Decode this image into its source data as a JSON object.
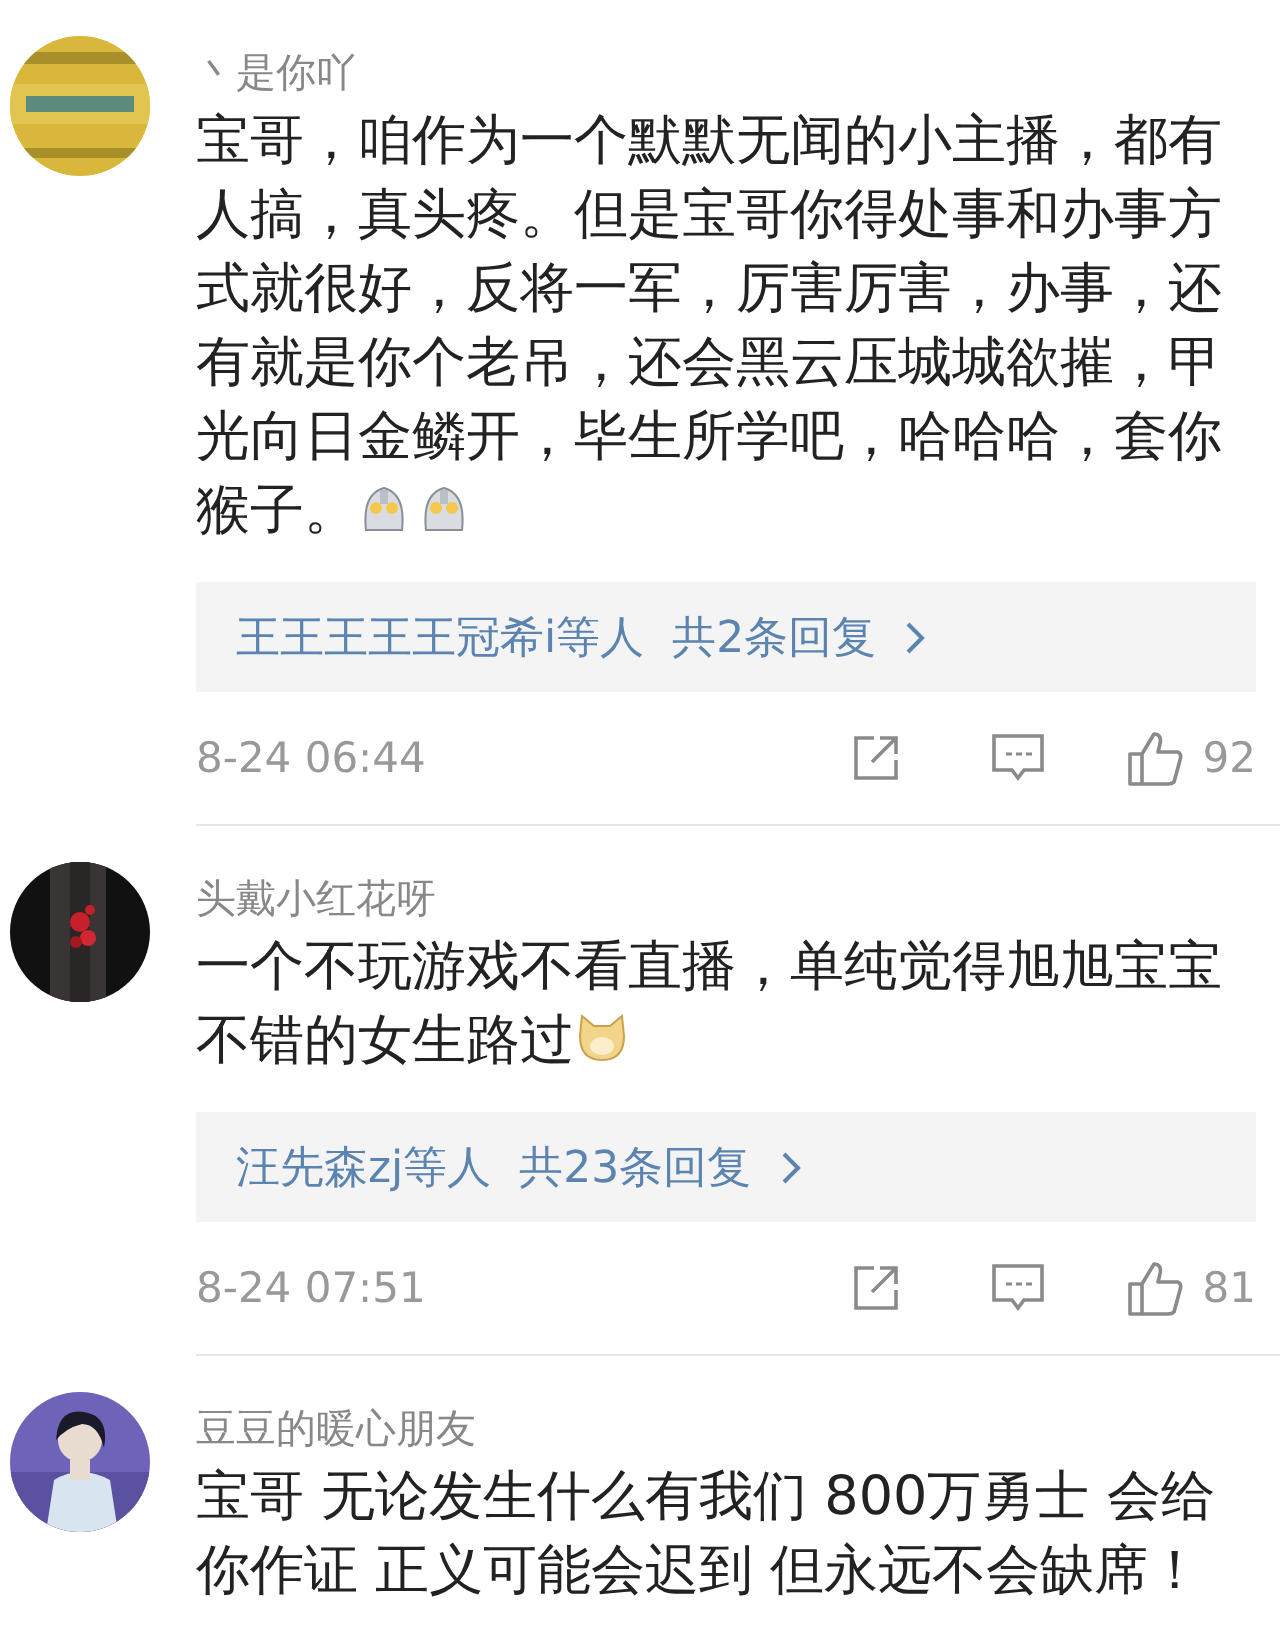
{
  "comments": [
    {
      "name": "丶是你吖",
      "text": "宝哥，咱作为一个默默无闻的小主播，都有人搞，真头疼。但是宝哥你得处事和办事方式就很好，反将一军，厉害厉害，办事，还有就是你个老吊，还会黑云压城城欲摧，甲光向日金鳞开，毕生所学吧，哈哈哈，套你猴子。",
      "emojis": [
        {
          "kind": "helmet"
        },
        {
          "kind": "helmet"
        }
      ],
      "replies": {
        "users": "王王王王王冠希i等人",
        "count": "共2条回复"
      },
      "time": "8-24 06:44",
      "likes": "92"
    },
    {
      "name": "头戴小红花呀",
      "text": "一个不玩游戏不看直播，单纯觉得旭旭宝宝不错的女生路过",
      "emojis": [
        {
          "kind": "dog"
        }
      ],
      "replies": {
        "users": "汪先森zj等人",
        "count": "共23条回复"
      },
      "time": "8-24 07:51",
      "likes": "81"
    },
    {
      "name": "豆豆的暖心朋友",
      "text": "宝哥 无论发生什么有我们 800万勇士 会给你作证 正义可能会迟到 但永远不会缺席！"
    }
  ]
}
